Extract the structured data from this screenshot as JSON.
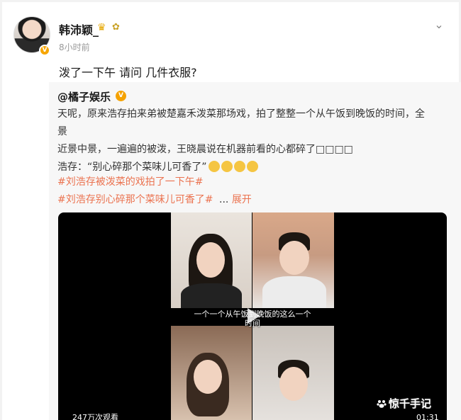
{
  "post": {
    "author": "韩沛颖_",
    "time": "8小时前",
    "text": "泼了一下午 请问 几件衣服?",
    "more": "⌄"
  },
  "repost": {
    "author": "@橘子娱乐",
    "verified": "V",
    "line1": "天呢，原来浩存拍来弟被楚嘉禾泼菜那场戏，拍了整整一个从午饭到晚饭的时间，全景",
    "line2": "近景中景，一遍遍的被泼，王晓晨说在机器前看的心都碎了□□□□",
    "line3": "浩存：“别心碎那个菜味儿可香了”",
    "hashtag1": "#刘浩存被泼菜的戏拍了一下午#",
    "hashtag2": "#刘浩存别心碎那个菜味儿可香了#",
    "ellipsis": "...",
    "expand": "展开"
  },
  "video": {
    "subtitle_line1": "一个一个从午饭到晚饭的这么一个",
    "subtitle_line2": "时间",
    "views": "247万次观看",
    "duration": "01:31"
  },
  "watermark": "惊千手记"
}
